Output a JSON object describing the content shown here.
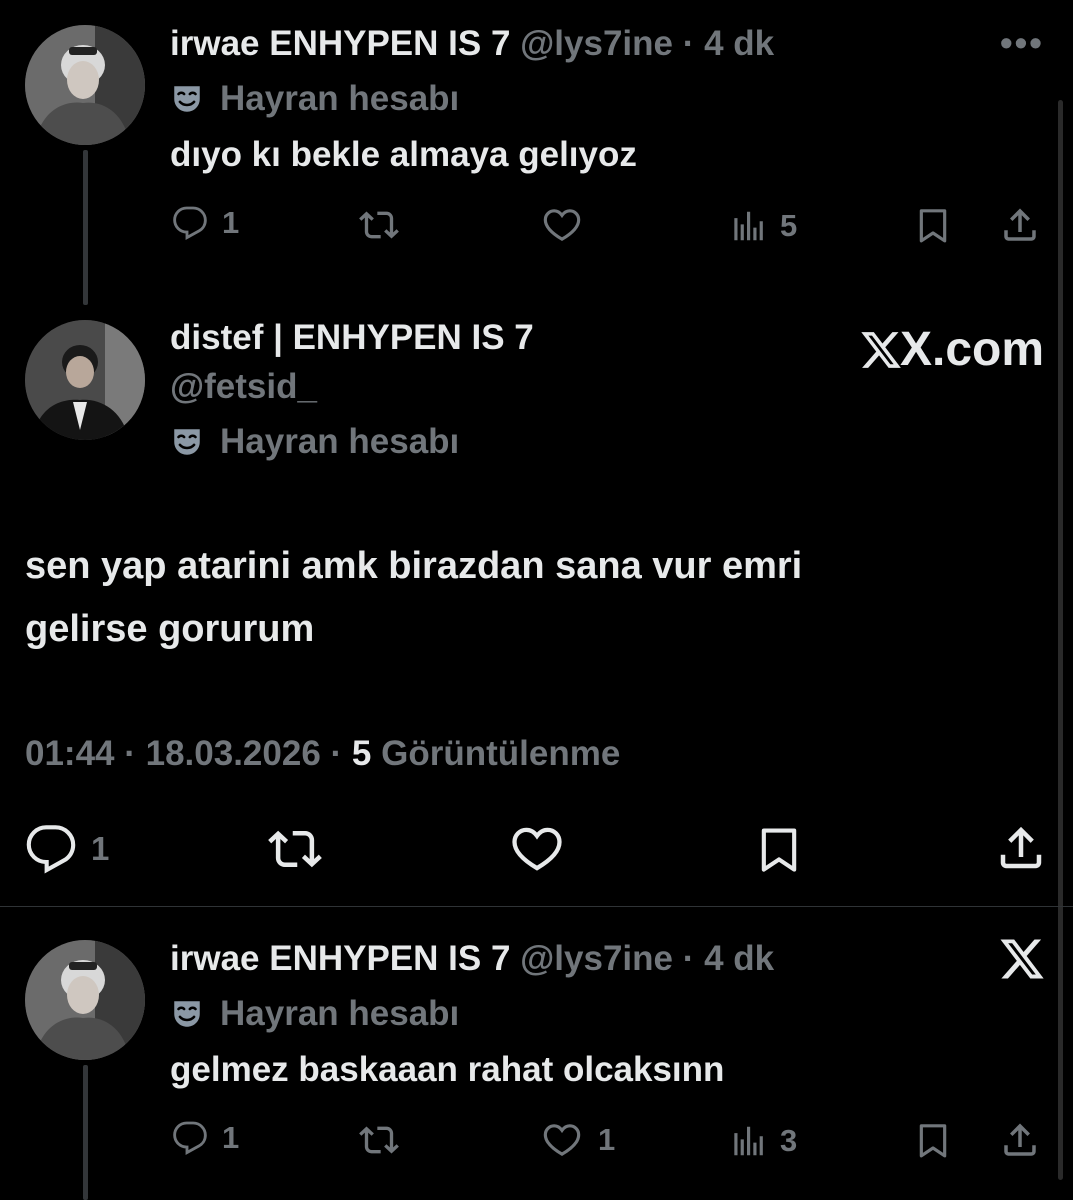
{
  "tweets": [
    {
      "name": "irwae ENHYPEN IS 7",
      "handle": "@lys7ine",
      "separator": "·",
      "time": "4 dk",
      "label": "Hayran hesabı",
      "text": "dıyo kı bekle almaya gelıyoz",
      "reply_count": "1",
      "views": "5"
    },
    {
      "name": "distef | ENHYPEN IS 7",
      "handle": "@fetsid_",
      "label": "Hayran hesabı",
      "text_line1": "sen yap atarini amk birazdan sana vur emri",
      "text_line2": "gelirse gorurum",
      "timestamp": "01:44 · 18.03.2026 ·",
      "view_count": "5",
      "view_label": "Görüntülenme",
      "reply_count": "1",
      "watermark": "X.com"
    },
    {
      "name": "irwae ENHYPEN IS 7",
      "handle": "@lys7ine",
      "separator": "·",
      "time": "4 dk",
      "label": "Hayran hesabı",
      "text": "gelmez baskaaan rahat olcaksınn",
      "reply_count": "1",
      "like_count": "1",
      "views": "3"
    }
  ],
  "icons": {
    "reply": "reply-icon",
    "retweet": "retweet-icon",
    "like": "like-icon",
    "views": "views-icon",
    "bookmark": "bookmark-icon",
    "share": "share-icon",
    "more": "more-icon",
    "x_logo": "x-logo-icon",
    "fan_mask": "theater-mask-icon"
  },
  "more_menu": "•••",
  "colors": {
    "background": "#000000",
    "text": "#e7e9ea",
    "muted": "#71767b",
    "divider": "#2f3336"
  }
}
